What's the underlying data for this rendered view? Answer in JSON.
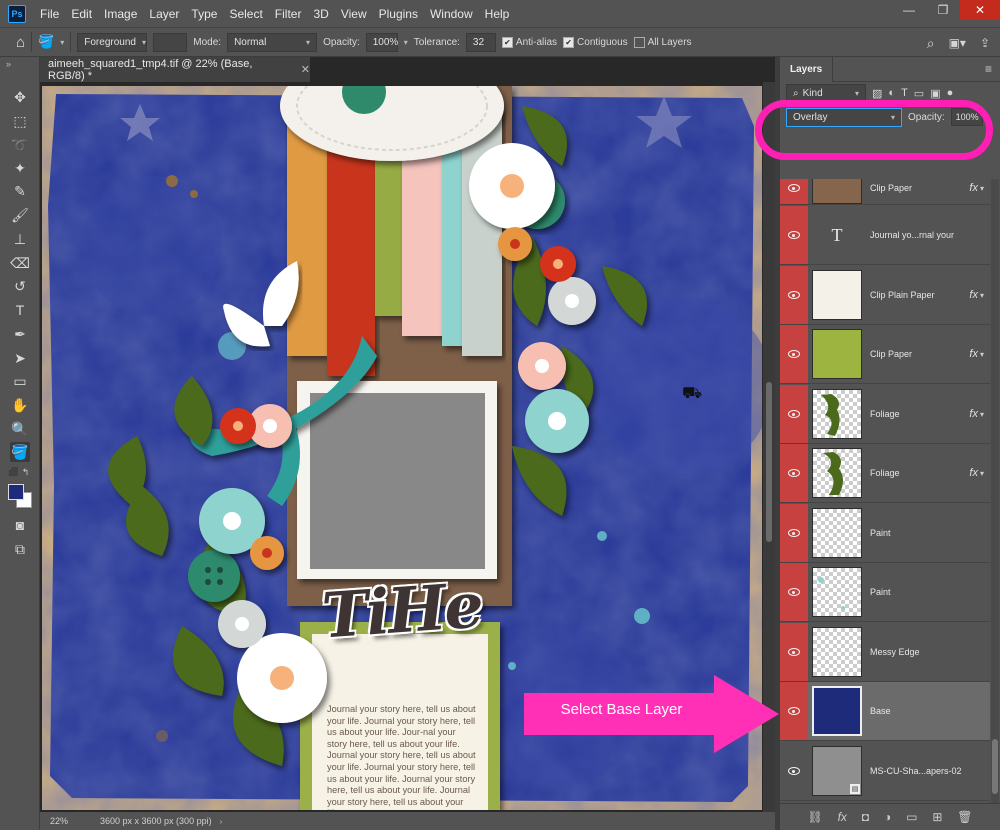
{
  "app": {
    "logo_text": "Ps",
    "menus": [
      "File",
      "Edit",
      "Image",
      "Layer",
      "Type",
      "Select",
      "Filter",
      "3D",
      "View",
      "Plugins",
      "Window",
      "Help"
    ]
  },
  "options": {
    "fill_source": "Foreground",
    "mode_label": "Mode:",
    "mode_value": "Normal",
    "opacity_label": "Opacity:",
    "opacity_value": "100%",
    "tolerance_label": "Tolerance:",
    "tolerance_value": "32",
    "anti_alias_label": "Anti-alias",
    "anti_alias_checked": true,
    "contiguous_label": "Contiguous",
    "contiguous_checked": true,
    "all_layers_label": "All Layers",
    "all_layers_checked": false
  },
  "document": {
    "tab_title": "aimeeh_squared1_tmp4.tif @ 22% (Base, RGB/8) *",
    "zoom": "22%",
    "size_info": "3600 px x 3600 px (300 ppi)",
    "title_art": "TiHe",
    "journal_text": "Journal your story here, tell us about your life. Journal your story here, tell us about your life. Jour-nal your story here, tell us about your life. Journal your story here, tell us about your life. Journal your story here, tell us about your life. Journal your story here, tell us about your life. Journal your story here, tell us about your life."
  },
  "layers_panel": {
    "tab_label": "Layers",
    "filter_kind": "Kind",
    "blend_mode": "Overlay",
    "opacity_label": "Opacity:",
    "opacity_value": "100%",
    "layers": [
      {
        "name": "Clip Paper",
        "fx": "fx",
        "thumb": "brown",
        "clip": false,
        "visible_marked": true
      },
      {
        "name": "Journal yo...rnal your",
        "fx": "",
        "thumb": "text",
        "clip": false,
        "visible_marked": true
      },
      {
        "name": "Clip Plain Paper",
        "fx": "fx",
        "thumb": "cream",
        "clip": false,
        "visible_marked": true
      },
      {
        "name": "Clip Paper",
        "fx": "fx",
        "thumb": "green",
        "clip": false,
        "visible_marked": true
      },
      {
        "name": "Foliage",
        "fx": "fx",
        "thumb": "foliage",
        "clip": false,
        "visible_marked": true
      },
      {
        "name": "Foliage",
        "fx": "fx",
        "thumb": "foliage",
        "clip": false,
        "visible_marked": true
      },
      {
        "name": "Paint",
        "fx": "",
        "thumb": "checker",
        "clip": false,
        "visible_marked": true
      },
      {
        "name": "Paint",
        "fx": "",
        "thumb": "checker",
        "clip": false,
        "visible_marked": true
      },
      {
        "name": "Messy Edge",
        "fx": "",
        "thumb": "checker",
        "clip": false,
        "visible_marked": true
      },
      {
        "name": "Base",
        "fx": "",
        "thumb": "navy",
        "clip": false,
        "visible_marked": true,
        "selected": true
      },
      {
        "name": "MS-CU-Sha...apers-02",
        "fx": "",
        "thumb": "gray",
        "clip": false,
        "visible_marked": false
      }
    ]
  },
  "annotation": {
    "callout_text": "Select Base Layer",
    "highlight_color": "#ff1fb4"
  },
  "colors": {
    "foreground": "#1e2a7a",
    "background": "#ffffff",
    "accent": "#31a8ff",
    "layer_eye_bg": "#c6413f"
  }
}
